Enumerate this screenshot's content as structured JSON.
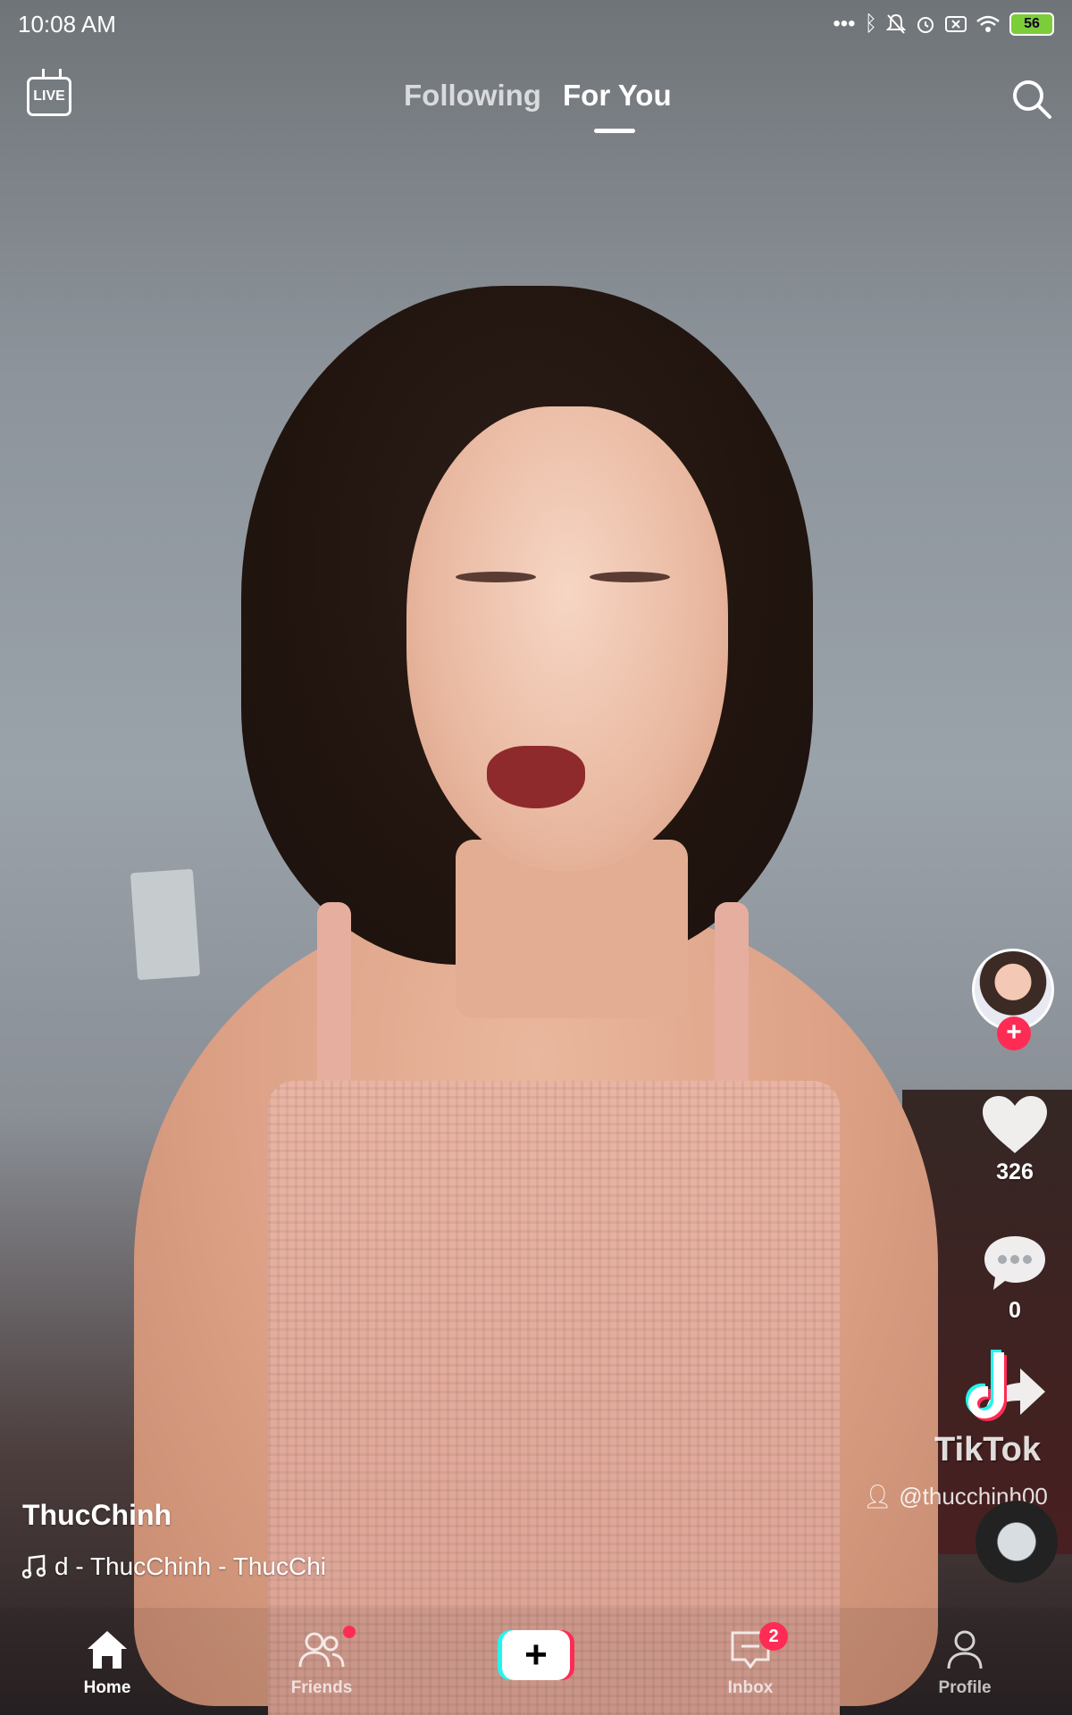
{
  "status_bar": {
    "time": "10:08 AM",
    "battery_level": "56",
    "icons": [
      "more-dots-icon",
      "bluetooth-icon",
      "mute-icon",
      "alarm-icon",
      "sim-icon",
      "wifi-icon",
      "battery-icon"
    ]
  },
  "top_nav": {
    "live_label": "LIVE",
    "tabs": [
      {
        "label": "Following",
        "active": false
      },
      {
        "label": "For You",
        "active": true
      }
    ]
  },
  "video": {
    "author_name": "ThucChinh",
    "sound_text": "d - ThucChinh - ThucChi",
    "likes": "326",
    "comments": "0",
    "share_count": "",
    "watermark_brand": "TikTok",
    "watermark_handle": "@thucchinh00"
  },
  "bottom_nav": {
    "items": [
      {
        "label": "Home",
        "icon": "home-icon",
        "active": true
      },
      {
        "label": "Friends",
        "icon": "friends-icon",
        "active": false
      },
      {
        "label": "",
        "icon": "plus-icon",
        "active": false
      },
      {
        "label": "Inbox",
        "icon": "inbox-icon",
        "active": false
      },
      {
        "label": "Profile",
        "icon": "profile-icon",
        "active": false
      }
    ],
    "inbox_badge": "2"
  },
  "colors": {
    "accent_red": "#fe2c55",
    "accent_cyan": "#25f4ee",
    "battery_green": "#7ccd3a"
  }
}
